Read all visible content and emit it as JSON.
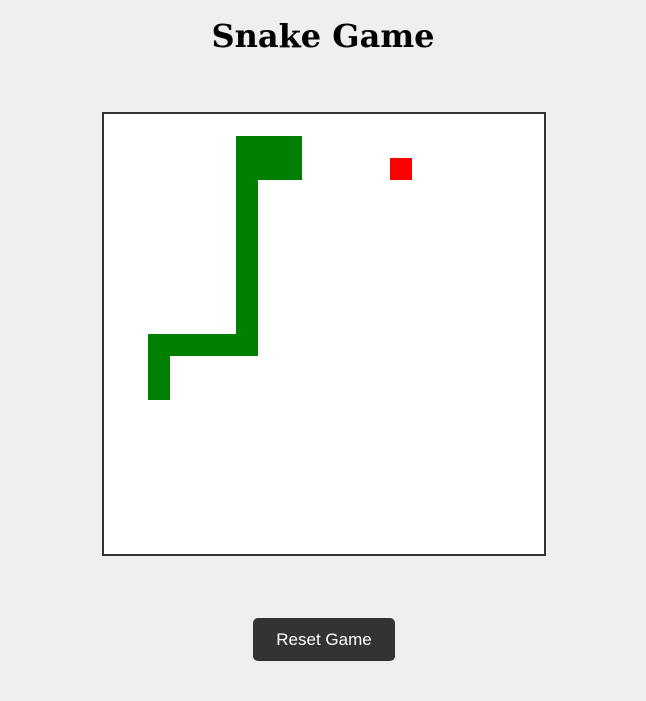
{
  "title": "Snake Game",
  "reset_label": "Reset Game",
  "colors": {
    "background": "#efefef",
    "board": "#ffffff",
    "board_border": "#333333",
    "snake": "#008000",
    "food": "#ff0000",
    "button": "#333333",
    "button_text": "#ffffff"
  },
  "game": {
    "grid_size": 20,
    "snake": [
      [
        6,
        1
      ],
      [
        7,
        1
      ],
      [
        8,
        1
      ],
      [
        6,
        2
      ],
      [
        7,
        2
      ],
      [
        8,
        2
      ],
      [
        6,
        3
      ],
      [
        6,
        4
      ],
      [
        6,
        5
      ],
      [
        6,
        6
      ],
      [
        6,
        7
      ],
      [
        6,
        8
      ],
      [
        6,
        9
      ],
      [
        5,
        10
      ],
      [
        4,
        10
      ],
      [
        3,
        10
      ],
      [
        2,
        10
      ],
      [
        6,
        10
      ],
      [
        2,
        11
      ],
      [
        2,
        12
      ]
    ],
    "food": [
      13,
      2
    ]
  }
}
